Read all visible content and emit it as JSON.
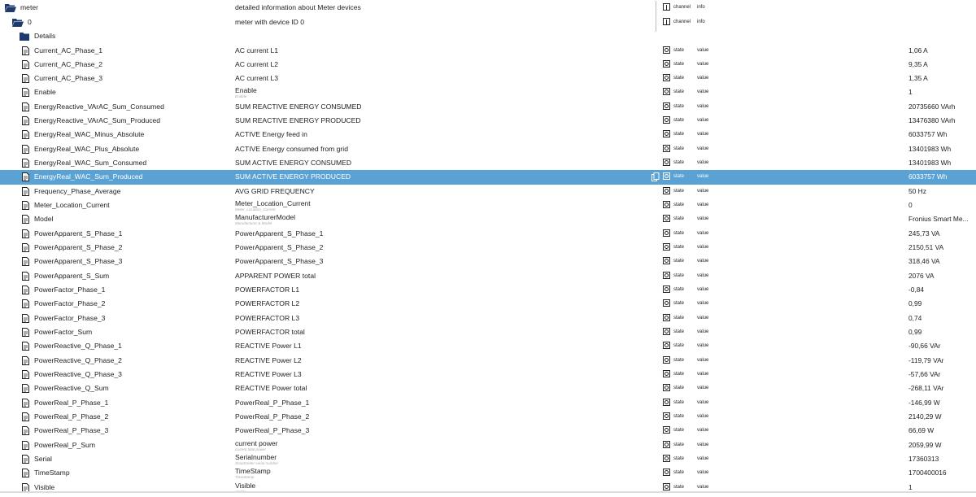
{
  "colors": {
    "selection": "#5aa1d4",
    "folder": "#1e3a6e",
    "text": "#222222"
  },
  "tree": {
    "folders": [
      {
        "name": "meter",
        "desc": "detailed information about Meter devices",
        "role": "channel",
        "type": "info"
      },
      {
        "name": "0",
        "desc": "meter with device ID 0",
        "role": "channel",
        "type": "info"
      },
      {
        "name": "Details"
      }
    ],
    "states": [
      {
        "name": "Current_AC_Phase_1",
        "desc": "AC current L1",
        "desc2": "",
        "role": "state",
        "type": "value",
        "value": "1,06 A"
      },
      {
        "name": "Current_AC_Phase_2",
        "desc": "AC current L2",
        "desc2": "",
        "role": "state",
        "type": "value",
        "value": "9,35 A"
      },
      {
        "name": "Current_AC_Phase_3",
        "desc": "AC current L3",
        "desc2": "",
        "role": "state",
        "type": "value",
        "value": "1,35 A"
      },
      {
        "name": "Enable",
        "desc": "Enable",
        "desc2": "Enable",
        "role": "state",
        "type": "value",
        "value": "1"
      },
      {
        "name": "EnergyReactive_VArAC_Sum_Consumed",
        "desc": "SUM REACTIVE ENERGY CONSUMED",
        "desc2": "",
        "role": "state",
        "type": "value",
        "value": "20735660 VArh"
      },
      {
        "name": "EnergyReactive_VArAC_Sum_Produced",
        "desc": "SUM REACTIVE ENERGY PRODUCED",
        "desc2": "",
        "role": "state",
        "type": "value",
        "value": "13476380 VArh"
      },
      {
        "name": "EnergyReal_WAC_Minus_Absolute",
        "desc": "ACTIVE Energy feed in",
        "desc2": "",
        "role": "state",
        "type": "value",
        "value": "6033757 Wh"
      },
      {
        "name": "EnergyReal_WAC_Plus_Absolute",
        "desc": "ACTIVE Energy consumed from grid",
        "desc2": "",
        "role": "state",
        "type": "value",
        "value": "13401983 Wh"
      },
      {
        "name": "EnergyReal_WAC_Sum_Consumed",
        "desc": "SUM ACTIVE ENERGY CONSUMED",
        "desc2": "",
        "role": "state",
        "type": "value",
        "value": "13401983 Wh"
      },
      {
        "name": "EnergyReal_WAC_Sum_Produced",
        "desc": "SUM ACTIVE ENERGY PRODUCED",
        "desc2": "",
        "role": "state",
        "type": "value",
        "value": "6033757 Wh",
        "selected": true
      },
      {
        "name": "Frequency_Phase_Average",
        "desc": "AVG GRID FREQUENCY",
        "desc2": "",
        "role": "state",
        "type": "value",
        "value": "50 Hz"
      },
      {
        "name": "Meter_Location_Current",
        "desc": "Meter_Location_Current",
        "desc2": "Meter_Location_Current",
        "role": "state",
        "type": "value",
        "value": "0"
      },
      {
        "name": "Model",
        "desc": "ManufacturerModel",
        "desc2": "Manufacturer & Model",
        "role": "state",
        "type": "value",
        "value": "Fronius Smart Me..."
      },
      {
        "name": "PowerApparent_S_Phase_1",
        "desc": "PowerApparent_S_Phase_1",
        "desc2": "",
        "role": "state",
        "type": "value",
        "value": "245,73 VA"
      },
      {
        "name": "PowerApparent_S_Phase_2",
        "desc": "PowerApparent_S_Phase_2",
        "desc2": "",
        "role": "state",
        "type": "value",
        "value": "2150,51 VA"
      },
      {
        "name": "PowerApparent_S_Phase_3",
        "desc": "PowerApparent_S_Phase_3",
        "desc2": "",
        "role": "state",
        "type": "value",
        "value": "318,46 VA"
      },
      {
        "name": "PowerApparent_S_Sum",
        "desc": "APPARENT POWER total",
        "desc2": "",
        "role": "state",
        "type": "value",
        "value": "2076 VA"
      },
      {
        "name": "PowerFactor_Phase_1",
        "desc": "POWERFACTOR L1",
        "desc2": "",
        "role": "state",
        "type": "value",
        "value": "-0,84"
      },
      {
        "name": "PowerFactor_Phase_2",
        "desc": "POWERFACTOR L2",
        "desc2": "",
        "role": "state",
        "type": "value",
        "value": "0,99"
      },
      {
        "name": "PowerFactor_Phase_3",
        "desc": "POWERFACTOR L3",
        "desc2": "",
        "role": "state",
        "type": "value",
        "value": "0,74"
      },
      {
        "name": "PowerFactor_Sum",
        "desc": "POWERFACTOR total",
        "desc2": "",
        "role": "state",
        "type": "value",
        "value": "0,99"
      },
      {
        "name": "PowerReactive_Q_Phase_1",
        "desc": "REACTIVE Power L1",
        "desc2": "",
        "role": "state",
        "type": "value",
        "value": "-90,66 VAr"
      },
      {
        "name": "PowerReactive_Q_Phase_2",
        "desc": "REACTIVE Power L2",
        "desc2": "",
        "role": "state",
        "type": "value",
        "value": "-119,79 VAr"
      },
      {
        "name": "PowerReactive_Q_Phase_3",
        "desc": "REACTIVE Power L3",
        "desc2": "",
        "role": "state",
        "type": "value",
        "value": "-57,66 VAr"
      },
      {
        "name": "PowerReactive_Q_Sum",
        "desc": "REACTIVE Power total",
        "desc2": "",
        "role": "state",
        "type": "value",
        "value": "-268,11 VAr"
      },
      {
        "name": "PowerReal_P_Phase_1",
        "desc": "PowerReal_P_Phase_1",
        "desc2": "",
        "role": "state",
        "type": "value",
        "value": "-146,99 W"
      },
      {
        "name": "PowerReal_P_Phase_2",
        "desc": "PowerReal_P_Phase_2",
        "desc2": "",
        "role": "state",
        "type": "value",
        "value": "2140,29 W"
      },
      {
        "name": "PowerReal_P_Phase_3",
        "desc": "PowerReal_P_Phase_3",
        "desc2": "",
        "role": "state",
        "type": "value",
        "value": "66,69 W"
      },
      {
        "name": "PowerReal_P_Sum",
        "desc": "current power",
        "desc2": "current total power",
        "role": "state",
        "type": "value",
        "value": "2059,99 W"
      },
      {
        "name": "Serial",
        "desc": "Serialnumber",
        "desc2": "Smartmeter serial number",
        "role": "state",
        "type": "value",
        "value": "17360313"
      },
      {
        "name": "TimeStamp",
        "desc": "TimeStamp",
        "desc2": "TimeStamp",
        "role": "state",
        "type": "value",
        "value": "1700400016"
      },
      {
        "name": "Visible",
        "desc": "Visible",
        "desc2": "Visible",
        "role": "state",
        "type": "value",
        "value": "1"
      }
    ]
  }
}
